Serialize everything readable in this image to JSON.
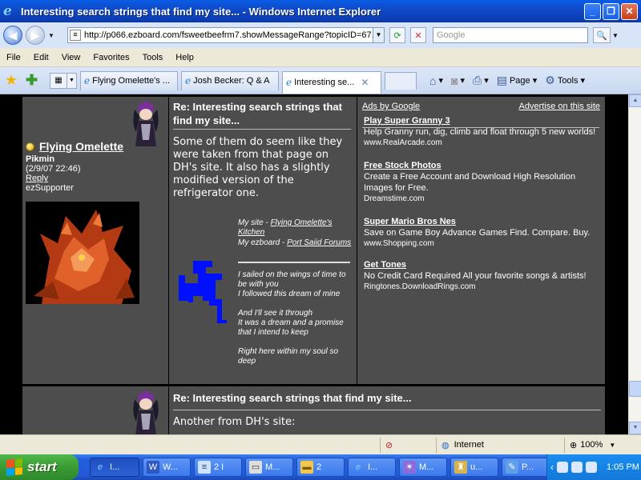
{
  "window": {
    "title": "Interesting search strings that find my site... - Windows Internet Explorer",
    "minimize": "_",
    "maximize": "❐",
    "close": "✕"
  },
  "address_bar": {
    "url": "http://p066.ezboard.com/fsweetbeefrm7.showMessageRange?topicID=67.t",
    "search_placeholder": "Google"
  },
  "menu": [
    "File",
    "Edit",
    "View",
    "Favorites",
    "Tools",
    "Help"
  ],
  "tabs": [
    {
      "label": "Flying Omelette's ...",
      "active": false
    },
    {
      "label": "Josh Becker: Q & A",
      "active": false
    },
    {
      "label": "Interesting se...",
      "active": true
    }
  ],
  "commands": {
    "page": "Page",
    "tools": "Tools"
  },
  "post1": {
    "username": "Flying Omelette",
    "rank": "Pikmin",
    "date": "(2/9/07 22:46)",
    "reply": "Reply",
    "badge": "ezSupporter",
    "title": "Re: Interesting search strings that find my site...",
    "body": "Some of them do seem like they were taken from that page on DH's site. It also has a slightly modified version of the refrigerator one.",
    "sig_site_label": "My site - ",
    "sig_site_link": "Flying Omelette's Kitchen",
    "sig_ezboard_label": "My ezboard - ",
    "sig_ezboard_link": "Port Saiid Forums",
    "sig_poem": [
      "I sailed on the wings of time to be with you",
      "I followed this dream of mine",
      "And I'll see it through",
      "It was a dream and a promise that I intend to keep",
      "Right here within my soul so deep"
    ]
  },
  "ads": {
    "header_left": "Ads by Google",
    "header_right": "Advertise on this site",
    "items": [
      {
        "title": "Play Super Granny 3",
        "text": "Help Granny run, dig, climb and float through 5 new worlds!",
        "url": "www.RealArcade.com"
      },
      {
        "title": "Free Stock Photos",
        "text": "Create a Free Account and Download High Resolution Images for Free.",
        "url": "Dreamstime.com"
      },
      {
        "title": "Super Mario Bros Nes",
        "text": "Save on Game Boy Advance Games Find. Compare. Buy.",
        "url": "www.Shopping.com"
      },
      {
        "title": "Get Tones",
        "text": "No Credit Card Required All your favorite songs & artists!",
        "url": "Ringtones.DownloadRings.com"
      }
    ]
  },
  "post2": {
    "title": "Re: Interesting search strings that find my site...",
    "body": "Another from DH's site:"
  },
  "status": {
    "zone": "Internet",
    "zoom": "100%"
  },
  "taskbar": {
    "start": "start",
    "buttons": [
      "I...",
      "W...",
      "2 I",
      "M...",
      "2 ",
      "I...",
      "M...",
      "u...",
      "P..."
    ],
    "clock": "1:05 PM"
  },
  "colors": {
    "forum_bg": "#4d4d4d",
    "page_bg": "#000000",
    "sig_blue": "#0000ff"
  }
}
